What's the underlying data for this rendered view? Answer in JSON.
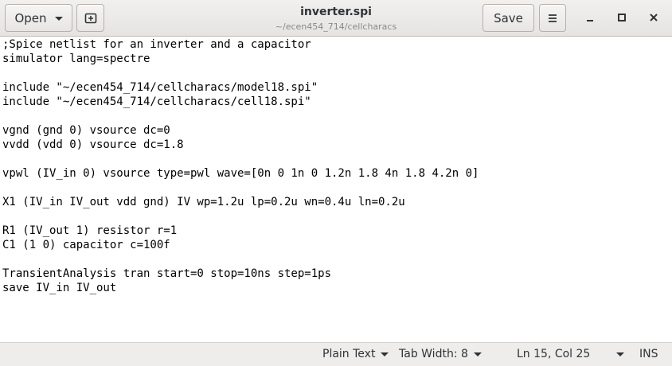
{
  "header": {
    "open_label": "Open",
    "title": "inverter.spi",
    "subtitle": "~/ecen454_714/cellcharacs",
    "save_label": "Save"
  },
  "editor": {
    "lines": [
      ";Spice netlist for an inverter and a capacitor",
      "simulator lang=spectre",
      "",
      "include \"~/ecen454_714/cellcharacs/model18.spi\"",
      "include \"~/ecen454_714/cellcharacs/cell18.spi\"",
      "",
      "vgnd (gnd 0) vsource dc=0",
      "vvdd (vdd 0) vsource dc=1.8",
      "",
      "vpwl (IV_in 0) vsource type=pwl wave=[0n 0 1n 0 1.2n 1.8 4n 1.8 4.2n 0]",
      "",
      "X1 (IV_in IV_out vdd gnd) IV wp=1.2u lp=0.2u wn=0.4u ln=0.2u",
      "",
      "R1 (IV_out 1) resistor r=1",
      "C1 (1 0) capacitor c=100f",
      "",
      "TransientAnalysis tran start=0 stop=10ns step=1ps",
      "save IV_in IV_out"
    ]
  },
  "statusbar": {
    "language": "Plain Text",
    "tab_width": "Tab Width: 8",
    "cursor_position": "Ln 15, Col 25",
    "insert_mode": "INS"
  }
}
